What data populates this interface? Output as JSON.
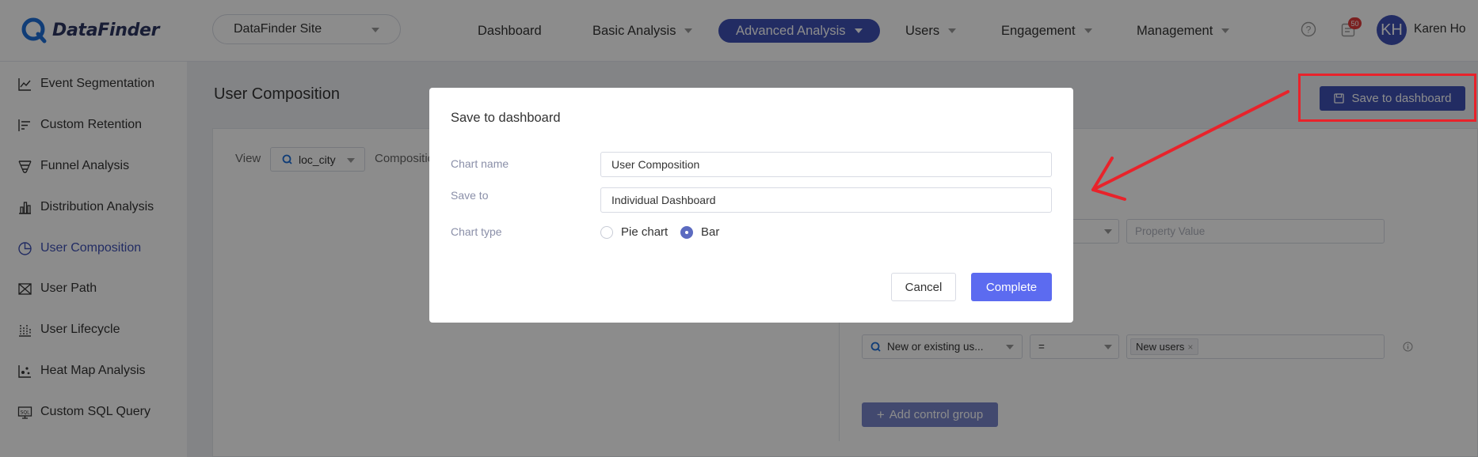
{
  "app": {
    "name": "DataFinder"
  },
  "site_select": {
    "value": "DataFinder Site"
  },
  "nav": {
    "items": [
      {
        "label": "Dashboard"
      },
      {
        "label": "Basic Analysis"
      },
      {
        "label": "Advanced Analysis"
      },
      {
        "label": "Users"
      },
      {
        "label": "Engagement"
      },
      {
        "label": "Management"
      }
    ],
    "active": "Advanced Analysis"
  },
  "notifications": {
    "count": "50"
  },
  "user": {
    "initials": "KH",
    "name": "Karen Ho"
  },
  "sidebar": {
    "items": [
      {
        "label": "Event Segmentation",
        "icon": "line-chart-icon"
      },
      {
        "label": "Custom Retention",
        "icon": "retention-icon"
      },
      {
        "label": "Funnel Analysis",
        "icon": "funnel-icon"
      },
      {
        "label": "Distribution Analysis",
        "icon": "bar-chart-icon"
      },
      {
        "label": "User Composition",
        "icon": "pie-chart-icon"
      },
      {
        "label": "User Path",
        "icon": "path-icon"
      },
      {
        "label": "User Lifecycle",
        "icon": "lifecycle-icon"
      },
      {
        "label": "Heat Map Analysis",
        "icon": "heatmap-icon"
      },
      {
        "label": "Custom SQL Query",
        "icon": "sql-icon"
      }
    ],
    "active": "User Composition"
  },
  "page": {
    "title": "User Composition",
    "save_button": "Save to dashboard",
    "view_label": "View",
    "view_value": "loc_city",
    "composition_label": "Compositio",
    "property_value_placeholder": "Property Value",
    "filter_property": "New or existing us...",
    "filter_operator": "=",
    "filter_tag": "New users",
    "add_control_group": "Add control group"
  },
  "modal": {
    "title": "Save to dashboard",
    "chart_name_label": "Chart name",
    "chart_name_value": "User Composition",
    "save_to_label": "Save to",
    "save_to_value": "Individual Dashboard",
    "chart_type_label": "Chart type",
    "chart_type_options": [
      "Pie chart",
      "Bar"
    ],
    "chart_type_selected": "Bar",
    "cancel": "Cancel",
    "complete": "Complete"
  },
  "colors": {
    "brand": "#3f51b5",
    "annotation": "#e8232b",
    "primary_button": "#5c6bf0"
  }
}
